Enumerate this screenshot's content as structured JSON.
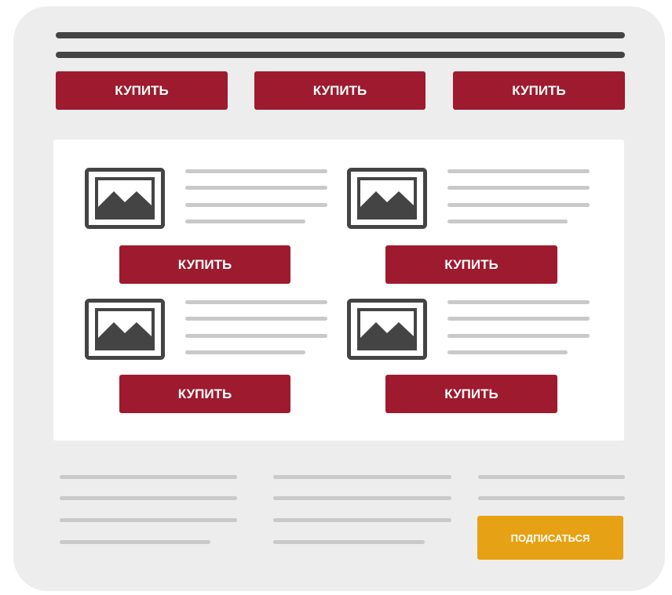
{
  "header": {
    "buttons": [
      {
        "label": "КУПИТЬ"
      },
      {
        "label": "КУПИТЬ"
      },
      {
        "label": "КУПИТЬ"
      }
    ]
  },
  "products": [
    {
      "icon": "image-icon",
      "button_label": "КУПИТЬ"
    },
    {
      "icon": "image-icon",
      "button_label": "КУПИТЬ"
    },
    {
      "icon": "image-icon",
      "button_label": "КУПИТЬ"
    },
    {
      "icon": "image-icon",
      "button_label": "КУПИТЬ"
    }
  ],
  "footer": {
    "subscribe_label": "ПОДПИСАТЬСЯ"
  },
  "colors": {
    "buy_button": "#9e1a2e",
    "subscribe_button": "#e6a214",
    "frame": "#ededed",
    "header_bar": "#444444",
    "text_placeholder": "#c9c9c9"
  }
}
